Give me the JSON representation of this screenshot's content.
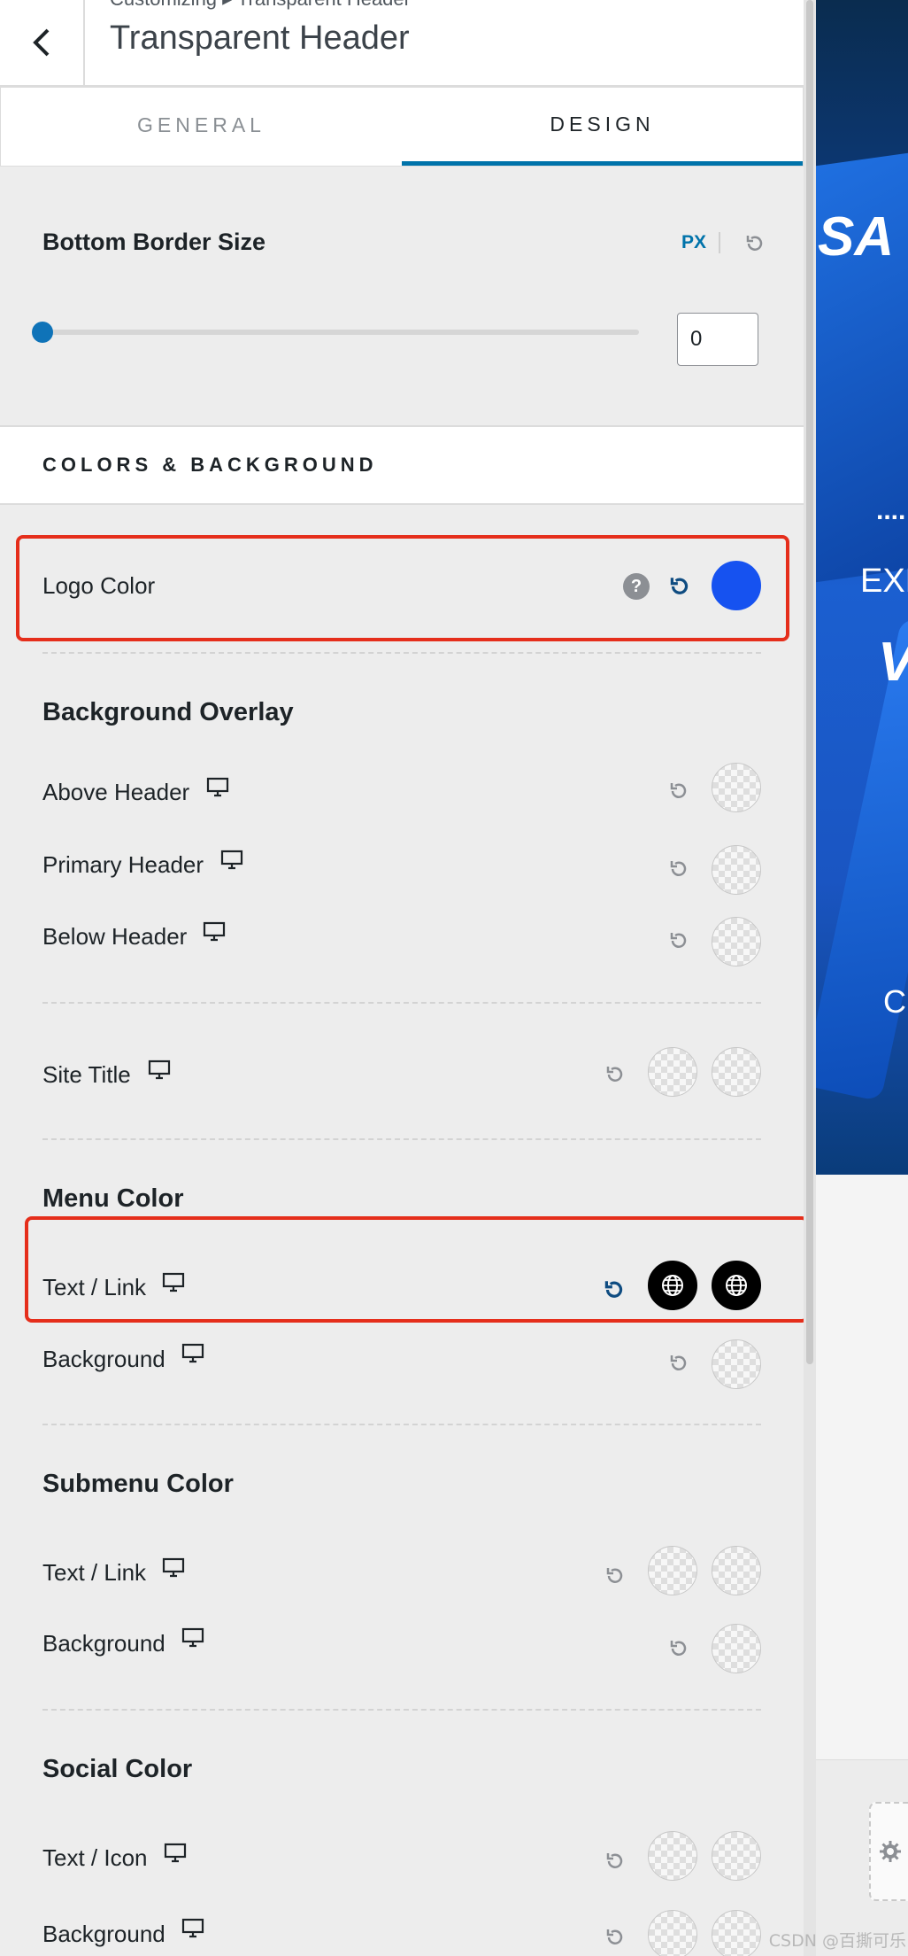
{
  "header": {
    "breadcrumb": "Customizing ▸ Transparent Header",
    "title": "Transparent Header"
  },
  "tabs": [
    {
      "label": "GENERAL",
      "active": false
    },
    {
      "label": "DESIGN",
      "active": true
    }
  ],
  "border": {
    "label": "Bottom Border Size",
    "unit": "PX",
    "value": "0",
    "slider_fraction": 0
  },
  "section": {
    "title": "COLORS & BACKGROUND"
  },
  "logo_color": {
    "label": "Logo Color",
    "help": "?",
    "color": "#1652f0"
  },
  "background_overlay": {
    "heading": "Background Overlay",
    "items": [
      {
        "label": "Above Header"
      },
      {
        "label": "Primary Header"
      },
      {
        "label": "Below Header"
      }
    ]
  },
  "site_title": {
    "label": "Site Title"
  },
  "menu_color": {
    "heading": "Menu Color",
    "text_link": "Text / Link",
    "background": "Background"
  },
  "submenu_color": {
    "heading": "Submenu Color",
    "text_link": "Text / Link",
    "background": "Background"
  },
  "social_color": {
    "heading": "Social Color",
    "text_icon": "Text / Icon",
    "background": "Background"
  },
  "preview": {
    "text1": "SA",
    "text2": "EXP",
    "text3": "V/",
    "text4": "C",
    "text5": "...."
  },
  "watermark": "CSDN @百撕可乐",
  "colors": {
    "accent": "#0073aa",
    "highlight": "#e52e1b",
    "logo_swatch": "#1652f0"
  }
}
